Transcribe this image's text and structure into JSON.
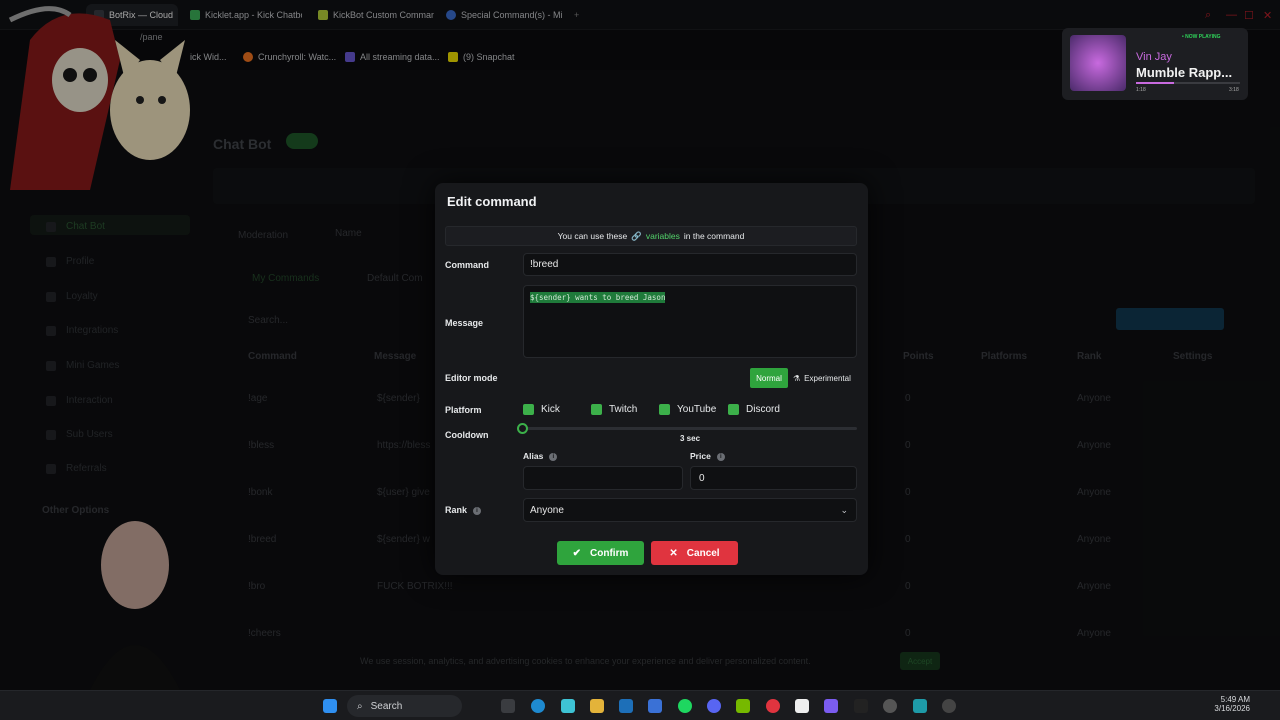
{
  "browser": {
    "tabs": [
      {
        "label": "BotRix — Cloud",
        "active": true
      },
      {
        "label": "Kicklet.app - Kick Chatbot",
        "active": false
      },
      {
        "label": "KickBot Custom Commands",
        "active": false
      },
      {
        "label": "Special Command(s) - Mi",
        "active": false
      }
    ],
    "url_partial": "/pane",
    "bookmarks": [
      {
        "label": "ick Wid..."
      },
      {
        "label": "Crunchyroll: Watc..."
      },
      {
        "label": "All streaming data..."
      },
      {
        "label": "(9) Snapchat"
      }
    ]
  },
  "now_playing": {
    "badge": "• NOW PLAYING",
    "artist": "Vin Jay",
    "title": "Mumble Rapp...",
    "elapsed": "1:18",
    "duration": "3:18",
    "progress": 0.37
  },
  "background_page": {
    "title": "Chat Bot",
    "sidebar": [
      "Chat Bot",
      "Profile",
      "Loyalty",
      "Integrations",
      "Mini Games",
      "Interaction",
      "Sub Users",
      "Referrals"
    ],
    "sidebar_section": "Other Options",
    "tabs": [
      "Moderation",
      "Name",
      "Co"
    ],
    "subtabs": [
      "My Commands",
      "Default Com"
    ],
    "search_placeholder": "Search...",
    "columns": [
      "Command",
      "Message",
      "Points",
      "Platforms",
      "Rank",
      "Settings"
    ],
    "rows": [
      {
        "command": "!age",
        "message": "${sender}",
        "points": "0",
        "rank": "Anyone"
      },
      {
        "command": "!bless",
        "message": "https://bless",
        "points": "0",
        "rank": "Anyone"
      },
      {
        "command": "!bonk",
        "message": "${user} give",
        "points": "0",
        "rank": "Anyone"
      },
      {
        "command": "!breed",
        "message": "${sender} w",
        "points": "0",
        "rank": "Anyone"
      },
      {
        "command": "!bro",
        "message": "FUCK BOTRIX!!!",
        "points": "0",
        "rank": "Anyone"
      },
      {
        "command": "!cheers",
        "message": "",
        "points": "0",
        "rank": "Anyone"
      }
    ],
    "cookie_text": "We use session, analytics, and advertising cookies to enhance your experience and deliver personalized content.",
    "cookie_button": "Accept"
  },
  "modal": {
    "title": "Edit command",
    "variables_hint_pre": "You can use these",
    "variables_link": "variables",
    "variables_hint_post": "in the command",
    "command_label": "Command",
    "command_value": "!breed",
    "message_label": "Message",
    "message_value": "${sender} wants to breed Jason",
    "editor_mode_label": "Editor mode",
    "editor_modes": [
      "Normal",
      "Experimental"
    ],
    "platform_label": "Platform",
    "platforms": [
      "Kick",
      "Twitch",
      "YouTube",
      "Discord"
    ],
    "cooldown_label": "Cooldown",
    "cooldown_value": "3 sec",
    "cooldown_fraction": 0.0,
    "alias_label": "Alias",
    "alias_value": "",
    "price_label": "Price",
    "price_value": "0",
    "rank_label": "Rank",
    "rank_value": "Anyone",
    "confirm_label": "Confirm",
    "cancel_label": "Cancel"
  },
  "taskbar": {
    "search_label": "Search",
    "time": "5:49 AM",
    "date": "3/16/2026"
  },
  "colors": {
    "accent_green": "#3cb04a",
    "cancel_red": "#e0343f",
    "variables_link": "#53d36b"
  }
}
